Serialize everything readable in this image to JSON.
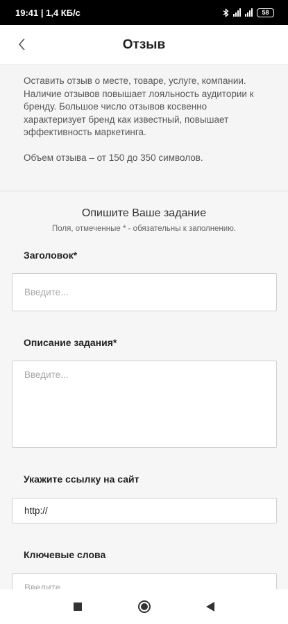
{
  "status_bar": {
    "time_speed": "19:41 | 1,4 КБ/с",
    "battery": "58",
    "icons": [
      "bluetooth-icon",
      "signal-icon",
      "signal-icon",
      "battery-icon"
    ]
  },
  "header": {
    "title": "Отзыв",
    "back_icon": "chevron-left-icon"
  },
  "intro": {
    "paragraph1": "Оставить отзыв о месте, товаре, услуге, компании. Наличие отзывов повышает лояльность аудитории к бренду. Большое число отзывов косвенно характеризует бренд как известный, повышает эффективность маркетинга.",
    "paragraph2": "Объем отзыва – от 150 до 350 символов."
  },
  "form": {
    "heading": "Опишите Ваше задание",
    "subheading": "Поля, отмеченные * - обязательны к заполнению.",
    "title_label": "Заголовок*",
    "title_placeholder": "Введите...",
    "description_label": "Описание задания*",
    "description_placeholder": "Введите...",
    "url_label": "Укажите ссылку на сайт",
    "url_value": "http://",
    "keywords_label": "Ключевые слова",
    "keywords_placeholder": "Введите..."
  },
  "nav_bar": {
    "icons": [
      "recents-square-icon",
      "home-circle-icon",
      "back-triangle-icon"
    ]
  },
  "colors": {
    "page_bg": "#f6f6f6",
    "header_bg": "#ffffff",
    "status_bg": "#000000",
    "input_border": "#cfcfcf",
    "placeholder": "#a8a8a8"
  }
}
